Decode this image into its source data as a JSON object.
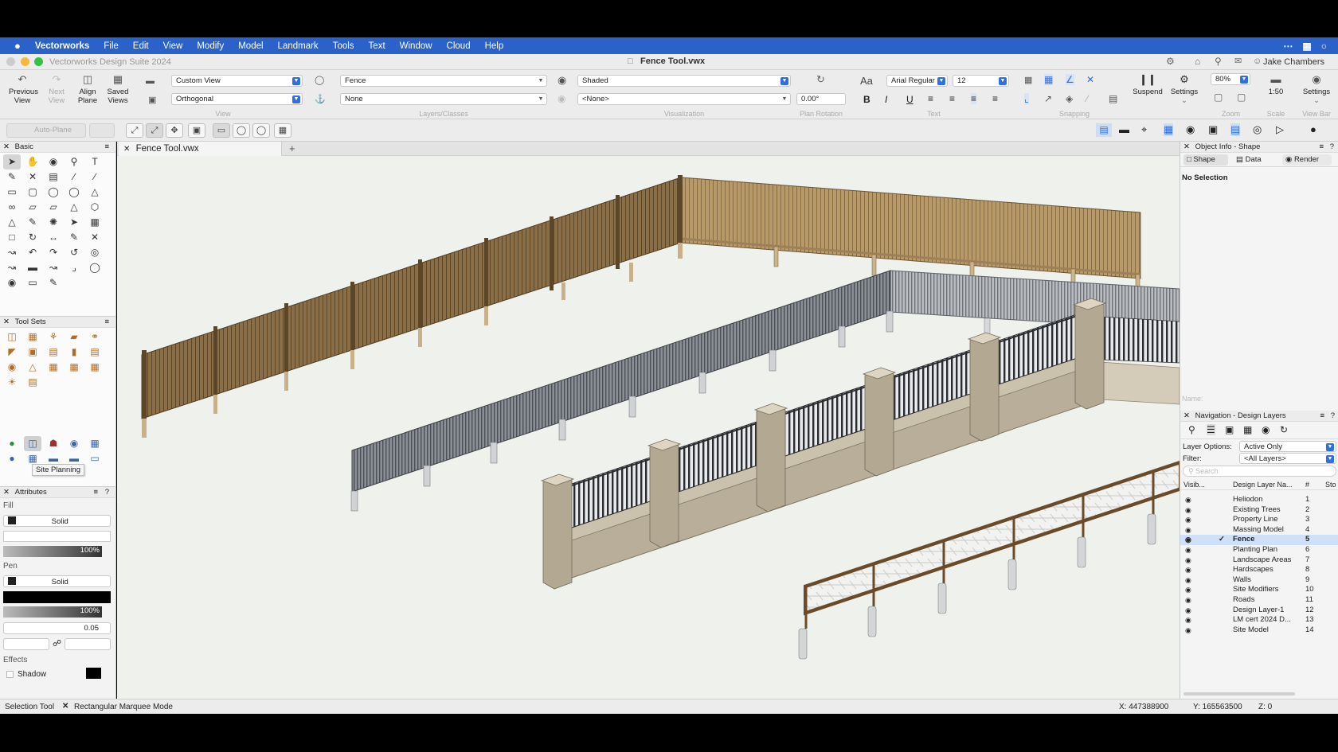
{
  "menubar": {
    "apple": "",
    "items": [
      "Vectorworks",
      "File",
      "Edit",
      "View",
      "Modify",
      "Model",
      "Landmark",
      "Tools",
      "Text",
      "Window",
      "Cloud",
      "Help"
    ]
  },
  "titlebar": {
    "app_title": "Vectorworks Design Suite 2024",
    "doc_title": "Fence Tool.vwx",
    "user": "Jake Chambers"
  },
  "toolbar": {
    "previous_view": "Previous View",
    "next_view": "Next View",
    "align_plane": "Align Plane",
    "saved_views": "Saved Views",
    "view_select": "Custom View",
    "projection_select": "Orthogonal",
    "view_group": "View",
    "layer_select": "Fence",
    "class_select": "None",
    "layers_group": "Layers/Classes",
    "render_select": "Shaded",
    "render2_select": "<None>",
    "visualization_group": "Visualization",
    "plan_rotation_value": "0.00°",
    "plan_rotation_group": "Plan Rotation",
    "font_select": "Arial Regular",
    "font_size": "12",
    "text_group": "Text",
    "snapping_group": "Snapping",
    "suspend": "Suspend",
    "settings": "Settings",
    "zoom_value": "80%",
    "zoom_group": "Zoom",
    "scale_value": "1:50",
    "scale_group": "Scale",
    "viewbar_settings": "Settings",
    "viewbar_group": "View Bar"
  },
  "modebar": {
    "auto_plane": "Auto-Plane"
  },
  "document_tab": {
    "label": "Fence Tool.vwx"
  },
  "left_panel": {
    "basic_title": "Basic",
    "toolsets_title": "Tool Sets",
    "tooltip": "Site Planning",
    "attributes_title": "Attributes",
    "fill_label": "Fill",
    "fill_style": "Solid",
    "fill_opacity": "100%",
    "pen_label": "Pen",
    "pen_style": "Solid",
    "pen_opacity": "100%",
    "line_weight": "0.05",
    "effects_label": "Effects",
    "shadow_label": "Shadow"
  },
  "right_panel": {
    "obj_info_title": "Object Info - Shape",
    "tab_shape": "Shape",
    "tab_data": "Data",
    "tab_render": "Render",
    "no_selection": "No Selection",
    "name_label": "Name:",
    "nav_title": "Navigation - Design Layers",
    "layer_options_label": "Layer Options:",
    "layer_options_value": "Active Only",
    "filter_label": "Filter:",
    "filter_value": "<All Layers>",
    "search_placeholder": "Search",
    "col_visibility": "Visib...",
    "col_name": "Design Layer Na...",
    "col_number": "#",
    "col_story": "Sto",
    "layers": [
      {
        "name": "Heliodon",
        "num": "1"
      },
      {
        "name": "Existing Trees",
        "num": "2"
      },
      {
        "name": "Property Line",
        "num": "3"
      },
      {
        "name": "Massing Model",
        "num": "4"
      },
      {
        "name": "Fence",
        "num": "5"
      },
      {
        "name": "Planting Plan",
        "num": "6"
      },
      {
        "name": "Landscape Areas",
        "num": "7"
      },
      {
        "name": "Hardscapes",
        "num": "8"
      },
      {
        "name": "Walls",
        "num": "9"
      },
      {
        "name": "Site Modifiers",
        "num": "10"
      },
      {
        "name": "Roads",
        "num": "11"
      },
      {
        "name": "Design Layer-1",
        "num": "12"
      },
      {
        "name": "LM cert 2024 D...",
        "num": "13"
      },
      {
        "name": "Site Model",
        "num": "14"
      }
    ],
    "active_layer_index": 4
  },
  "statusbar": {
    "tool": "Selection Tool",
    "mode": "Rectangular Marquee Mode",
    "x": "X: 447388900",
    "y": "Y: 165563500",
    "z": "Z: 0"
  },
  "colors": {
    "menubar": "#2b62c9",
    "accent": "#2f6fe0",
    "canvas": "#eef1ec",
    "wood_fence": "#8a6e48",
    "metal_fence": "#7c7f86",
    "wall": "#b5ab98"
  }
}
